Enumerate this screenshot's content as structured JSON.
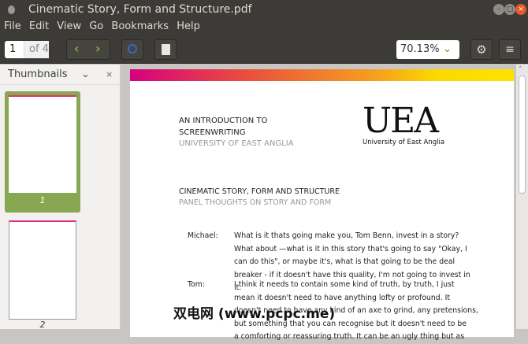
{
  "window": {
    "title": "Cinematic Story, Form and Structure.pdf"
  },
  "menu": [
    "File",
    "Edit",
    "View",
    "Go",
    "Bookmarks",
    "Help"
  ],
  "toolbar": {
    "page_current": "1",
    "page_total": "of 4",
    "zoom": "70.13%"
  },
  "sidebar": {
    "title": "Thumbnails",
    "pages": [
      "1",
      "2"
    ]
  },
  "page": {
    "intro_line1": "AN INTRODUCTION TO",
    "intro_line2": "SCREENWRITING",
    "university": "UNIVERSITY OF EAST ANGLIA",
    "logo_text": "UEA",
    "logo_sub": "University of East Anglia",
    "title": "CINEMATIC STORY, FORM AND STRUCTURE",
    "subtitle": "PANEL THOUGHTS ON STORY AND FORM",
    "dialogue": [
      {
        "speaker": "Michael:",
        "lines": [
          "What is it thats going make you, Tom Benn, invest in a story?",
          "What about —what is it in this story that's going to say \"Okay, I",
          "can do this\", or maybe it's, what is that going to be the deal",
          "breaker - if it doesn't have this quality, I'm not going to invest in",
          "it."
        ]
      },
      {
        "speaker": "Tom:",
        "lines": [
          "I think it needs to contain some kind of truth, by truth, I just",
          "mean it doesn't need to have anything lofty or profound. It",
          "doesn't need to have any kind of an axe to grind, any pretensions,",
          "but something that you can recognise but it doesn't need to be",
          "a comforting or reassuring truth. It can be an ugly thing but as"
        ]
      }
    ]
  },
  "watermark": "双电网 (www.pcpc.me)"
}
